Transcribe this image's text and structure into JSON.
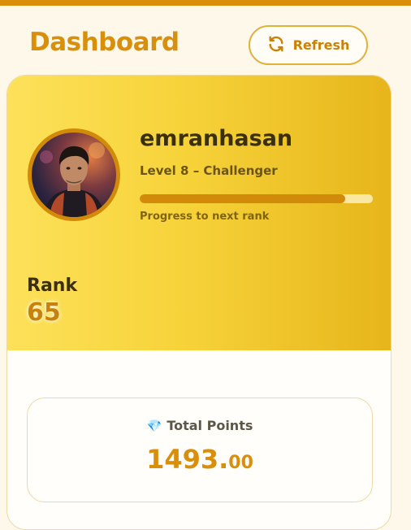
{
  "header": {
    "title": "Dashboard",
    "refresh_label": "Refresh"
  },
  "profile": {
    "username": "emranhasan",
    "level": "Level 8 – Challenger",
    "progress_fraction": 0.88,
    "progress_label": "Progress to next rank",
    "rank_label": "Rank",
    "rank_value": "65"
  },
  "points": {
    "label": "Total Points",
    "value_int": "1493.",
    "value_dec": "00",
    "icon": "gem-icon"
  },
  "colors": {
    "accent": "#d98f0a",
    "hero_start": "#fde15a",
    "hero_end": "#e6b51b",
    "background": "#fdf8ea"
  }
}
